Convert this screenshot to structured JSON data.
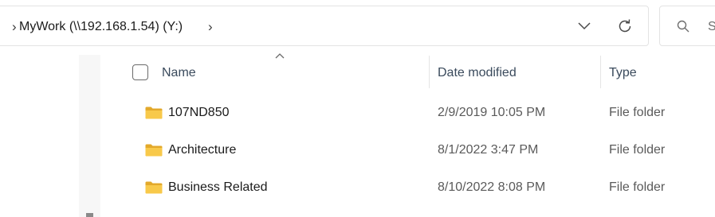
{
  "address_bar": {
    "path_label": "MyWork (\\\\192.168.1.54) (Y:)",
    "leading_chevron": "›",
    "trailing_chevron": "›",
    "dropdown_icon": "chevron-down-icon",
    "refresh_icon": "refresh-icon"
  },
  "search": {
    "icon": "search-icon",
    "placeholder_visible": "S"
  },
  "columns": {
    "name": "Name",
    "date_modified": "Date modified",
    "type": "Type"
  },
  "files": [
    {
      "name": "107ND850",
      "date_modified": "2/9/2019 10:05 PM",
      "type": "File folder",
      "icon": "folder-icon"
    },
    {
      "name": "Architecture",
      "date_modified": "8/1/2022 3:47 PM",
      "type": "File folder",
      "icon": "folder-icon"
    },
    {
      "name": "Business Related",
      "date_modified": "8/10/2022 8:08 PM",
      "type": "File folder",
      "icon": "folder-icon"
    }
  ],
  "colors": {
    "folder_yellow": "#f8c94a",
    "folder_dark": "#e3a92b",
    "header_text": "#3a4a5c",
    "border": "#e3e3e3"
  }
}
